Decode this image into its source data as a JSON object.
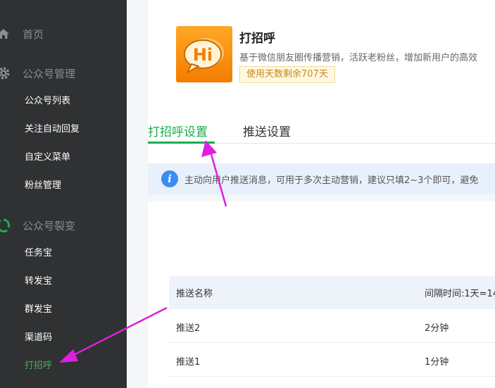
{
  "sidebar": {
    "home": {
      "label": "首页",
      "icon": "home-icon"
    },
    "account_mgmt": {
      "label": "公众号管理",
      "icon": "gear-icon",
      "items": [
        {
          "label": "公众号列表"
        },
        {
          "label": "关注自动回复"
        },
        {
          "label": "自定义菜单"
        },
        {
          "label": "粉丝管理"
        }
      ]
    },
    "fission": {
      "label": "公众号裂变",
      "icon": "recycle-icon",
      "items": [
        {
          "label": "任务宝"
        },
        {
          "label": "转发宝"
        },
        {
          "label": "群发宝"
        },
        {
          "label": "渠道码"
        },
        {
          "label": "打招呼"
        }
      ],
      "active_index": 4
    }
  },
  "app": {
    "logo_text": "Hi",
    "title": "打招呼",
    "description": "基于微信朋友圈传播营销，活跃老粉丝，增加新用户的高效",
    "badge": "使用天数剩余707天"
  },
  "tabs": [
    {
      "label": "打招呼设置",
      "active": true
    },
    {
      "label": "推送设置",
      "active": false
    }
  ],
  "notice": {
    "icon": "info-icon",
    "text": "主动向用户推送消息，可用于多次主动营销，建议只填2~3个即可，避免"
  },
  "table": {
    "headers": [
      "推送名称",
      "间隔时间:1天=14"
    ],
    "rows": [
      [
        "推送2",
        "2分钟"
      ],
      [
        "推送1",
        "1分钟"
      ]
    ]
  },
  "colors": {
    "sidebar_bg": "#2f3133",
    "accent_green": "#1aad4e",
    "annotation_magenta": "#e01ee0"
  }
}
